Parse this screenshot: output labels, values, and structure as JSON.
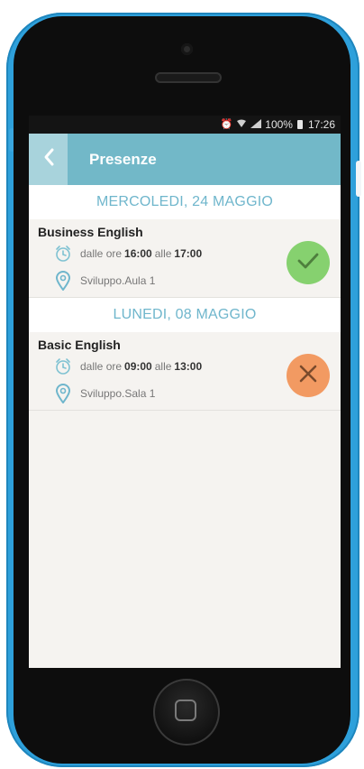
{
  "status_bar": {
    "battery_percent": "100%",
    "time": "17:26"
  },
  "header": {
    "title": "Presenze"
  },
  "sections": [
    {
      "date": "MERCOLEDI, 24 MAGGIO",
      "event": {
        "title": "Business English",
        "time_prefix": "dalle ore",
        "start": "16:00",
        "time_mid": "alle",
        "end": "17:00",
        "location": "Sviluppo.Aula 1",
        "status": "present",
        "status_icon": "check-icon",
        "status_color": "#86d16f"
      }
    },
    {
      "date": "LUNEDI, 08 MAGGIO",
      "event": {
        "title": "Basic English",
        "time_prefix": "dalle ore",
        "start": "09:00",
        "time_mid": "alle",
        "end": "13:00",
        "location": "Sviluppo.Sala 1",
        "status": "absent",
        "status_icon": "close-icon",
        "status_color": "#f29a62"
      }
    }
  ],
  "colors": {
    "phone_body": "#2ea0db",
    "app_bar": "#72b8c8",
    "accent_text": "#6fb6cc"
  }
}
